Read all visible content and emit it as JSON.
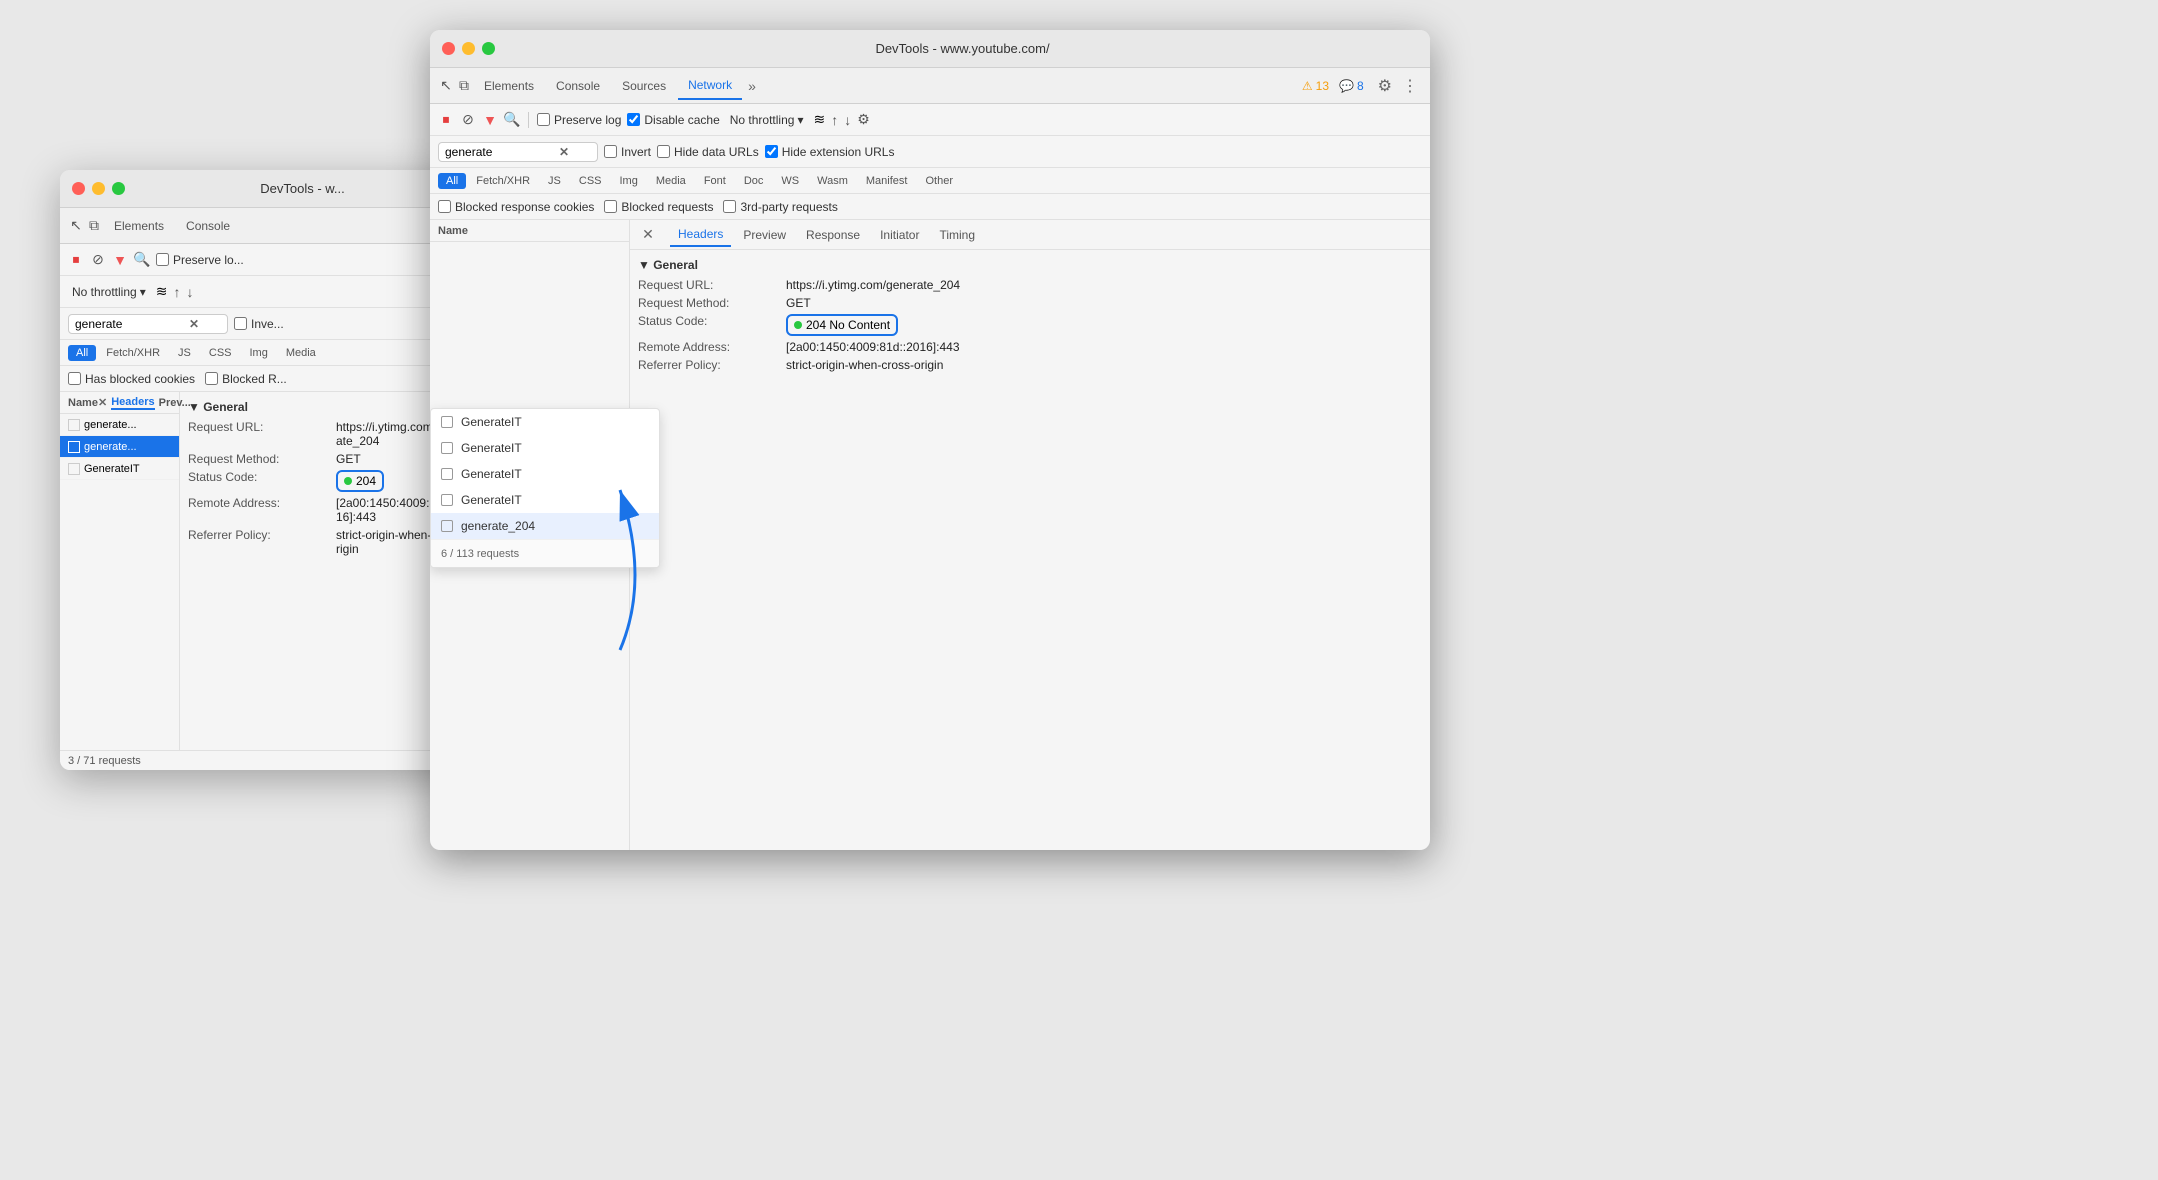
{
  "back_window": {
    "title": "DevTools - w...",
    "tabs": [
      "Elements",
      "Console"
    ],
    "toolbar": {
      "preserve_log": "Preserve lo...",
      "no_throttling": "No throttling",
      "invert": "Inve..."
    },
    "search_value": "generate",
    "filter_chips": [
      "All",
      "Fetch/XHR",
      "JS",
      "CSS",
      "Img",
      "Media"
    ],
    "blocked_row": "Has blocked cookies",
    "blocked_r": "Blocked R...",
    "name_col": "Name",
    "rows": [
      {
        "name": "generate...",
        "selected": false
      },
      {
        "name": "generate...",
        "selected": true
      },
      {
        "name": "GenerateIT",
        "selected": false
      }
    ],
    "detail_section": "▼ General",
    "details": [
      {
        "key": "Request URL:",
        "value": "https://i.ytimg.com/generate_204"
      },
      {
        "key": "Request Method:",
        "value": "GET"
      }
    ],
    "status_code_key": "Status Code:",
    "status_code_value": "204",
    "remote_address_key": "Remote Address:",
    "remote_address_value": "[2a00:1450:4009:821::2016]:443",
    "referrer_policy_key": "Referrer Policy:",
    "referrer_policy_value": "strict-origin-when-cross-origin",
    "footer": "3 / 71 requests",
    "tabs2": {
      "name": "Name",
      "x": "✕",
      "headers": "Headers",
      "prev": "Prev..."
    }
  },
  "front_window": {
    "title": "DevTools - www.youtube.com/",
    "tabs": [
      "Elements",
      "Console",
      "Sources",
      "Network",
      "»"
    ],
    "active_tab": "Network",
    "warning_count": "13",
    "info_count": "8",
    "toolbar1": {
      "preserve_log": "Preserve log",
      "disable_cache": "Disable cache",
      "no_throttling": "No throttling"
    },
    "toolbar2": {
      "invert": "Invert",
      "hide_data_urls": "Hide data URLs",
      "hide_extension_urls": "Hide extension URLs"
    },
    "search_value": "generate",
    "filter_chips": [
      "All",
      "Fetch/XHR",
      "JS",
      "CSS",
      "Img",
      "Media",
      "Font",
      "Doc",
      "WS",
      "Wasm",
      "Manifest",
      "Other"
    ],
    "active_filter": "All",
    "blocked_options": [
      "Blocked response cookies",
      "Blocked requests",
      "3rd-party requests"
    ],
    "suggestions": [
      {
        "name": "GenerateIT",
        "highlighted": false
      },
      {
        "name": "GenerateIT",
        "highlighted": false
      },
      {
        "name": "GenerateIT",
        "highlighted": false
      },
      {
        "name": "GenerateIT",
        "highlighted": false
      },
      {
        "name": "generate_204",
        "highlighted": true
      }
    ],
    "suggestion_footer": "6 / 113 requests",
    "name_col": "Name",
    "details_tabs": {
      "close": "✕",
      "headers": "Headers",
      "preview": "Preview",
      "response": "Response",
      "initiator": "Initiator",
      "timing": "Timing"
    },
    "active_details_tab": "Headers",
    "general_section_title": "▼ General",
    "details": [
      {
        "key": "Request URL:",
        "value": "https://i.ytimg.com/generate_204"
      },
      {
        "key": "Request Method:",
        "value": "GET"
      },
      {
        "key": "Status Code:",
        "value": "204 No Content",
        "highlighted": true
      },
      {
        "key": "Remote Address:",
        "value": "[2a00:1450:4009:81d::2016]:443"
      },
      {
        "key": "Referrer Policy:",
        "value": "strict-origin-when-cross-origin"
      }
    ]
  },
  "icons": {
    "stop": "⏹",
    "clear": "⊘",
    "filter": "▼",
    "search": "🔍",
    "cursor": "↖",
    "device": "⧉",
    "more": "»",
    "gear": "⚙",
    "dots": "⋮",
    "upload": "↑",
    "download": "↓",
    "warning": "⚠",
    "chat": "💬",
    "wifi": "≈",
    "triangle_down": "▼",
    "chevron_down": "▾",
    "arrow_down": "↓"
  }
}
